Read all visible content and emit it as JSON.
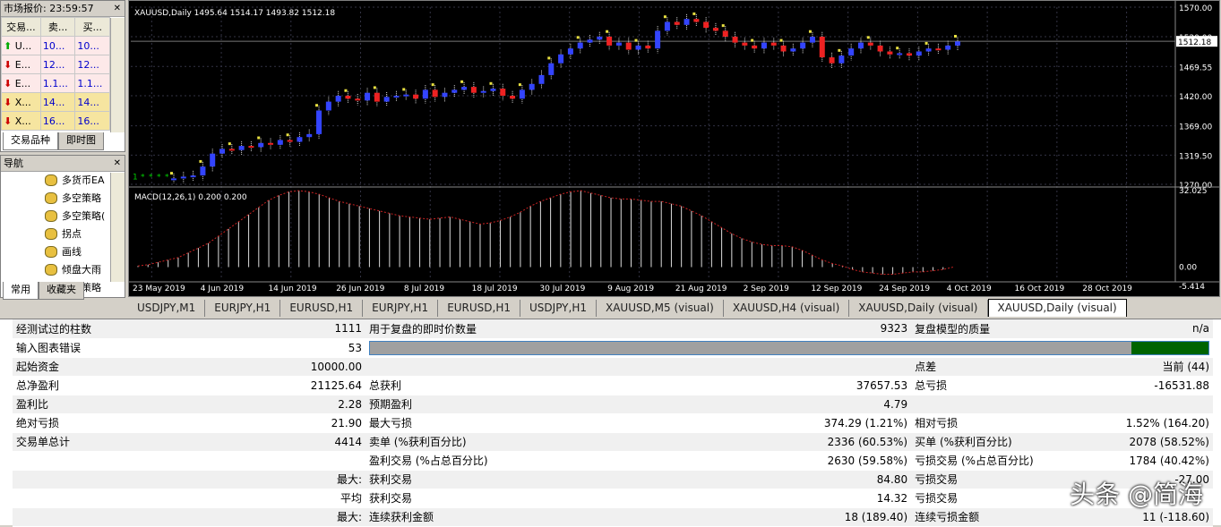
{
  "market_watch": {
    "title": "市场报价: 23:59:57",
    "col_symbol": "交易...",
    "col_bid": "卖...",
    "col_ask": "买...",
    "rows": [
      {
        "symbol": "U...",
        "bid": "10...",
        "ask": "10...",
        "dir": "up"
      },
      {
        "symbol": "E...",
        "bid": "12...",
        "ask": "12...",
        "dir": "down"
      },
      {
        "symbol": "E...",
        "bid": "1.1...",
        "ask": "1.1...",
        "dir": "down"
      },
      {
        "symbol": "X...",
        "bid": "14...",
        "ask": "14...",
        "dir": "down"
      },
      {
        "symbol": "X...",
        "bid": "16...",
        "ask": "16...",
        "dir": "down"
      }
    ],
    "tab_symbols": "交易品种",
    "tab_tick": "即时图"
  },
  "navigator": {
    "title": "导航",
    "items": [
      "多货币EA",
      "多空策略",
      "多空策略(",
      "拐点",
      "画线",
      "倾盘大雨",
      "趋势策略"
    ],
    "tab_common": "常用",
    "tab_favorites": "收藏夹"
  },
  "chart": {
    "header": "XAUUSD,Daily  1495.64 1514.17 1493.82 1512.18",
    "macd_label": "MACD(12,26,1) 0.200 0.200",
    "price_ticks": [
      "1570.00",
      "1520.00",
      "1469.55",
      "1420.00",
      "1369.00",
      "1319.50",
      "1270.00"
    ],
    "current_price": "1512.18",
    "macd_ticks": [
      "32.025",
      "0.00",
      "-5.414"
    ],
    "date_ticks": [
      "23 May 2019",
      "4 Jun 2019",
      "14 Jun 2019",
      "26 Jun 2019",
      "8 Jul 2019",
      "18 Jul 2019",
      "30 Jul 2019",
      "9 Aug 2019",
      "21 Aug 2019",
      "2 Sep 2019",
      "12 Sep 2019",
      "24 Sep 2019",
      "4 Oct 2019",
      "16 Oct 2019",
      "28 Oct 2019"
    ],
    "price_close": [
      1280,
      1283,
      1285,
      1300,
      1322,
      1330,
      1328,
      1335,
      1333,
      1340,
      1337,
      1345,
      1342,
      1350,
      1355,
      1395,
      1410,
      1420,
      1415,
      1412,
      1425,
      1410,
      1418,
      1420,
      1422,
      1415,
      1430,
      1418,
      1425,
      1430,
      1435,
      1425,
      1428,
      1432,
      1420,
      1415,
      1430,
      1440,
      1455,
      1475,
      1490,
      1500,
      1510,
      1515,
      1520,
      1505,
      1510,
      1498,
      1505,
      1500,
      1530,
      1545,
      1540,
      1550,
      1545,
      1535,
      1530,
      1520,
      1510,
      1505,
      1500,
      1510,
      1505,
      1495,
      1500,
      1510,
      1520,
      1485,
      1475,
      1488,
      1500,
      1510,
      1505,
      1495,
      1490,
      1492,
      1488,
      1495,
      1500,
      1498,
      1505,
      1512
    ],
    "macd": [
      0.5,
      1,
      2,
      3,
      4,
      6,
      8,
      10,
      13,
      16,
      19,
      22,
      25,
      28,
      30,
      31.5,
      32,
      31.5,
      30.5,
      29,
      27.5,
      26.5,
      25.5,
      24.5,
      23.5,
      22.5,
      21.5,
      21,
      20.5,
      20,
      20.5,
      21,
      20,
      19,
      18,
      18.5,
      19.5,
      21,
      23,
      25.5,
      27.5,
      29,
      30.5,
      31.5,
      32,
      31,
      30,
      29,
      28.5,
      28.5,
      28,
      27.5,
      27.5,
      26.5,
      25.5,
      23.5,
      21.5,
      19,
      16.5,
      14,
      12,
      10.5,
      9.5,
      9,
      9,
      8.5,
      7,
      5,
      3,
      1.5,
      0.5,
      -1,
      -2,
      -2.5,
      -3,
      -3,
      -2.5,
      -2,
      -2,
      -1.5,
      -1,
      0
    ]
  },
  "chart_tabs": [
    "USDJPY,M1",
    "EURJPY,H1",
    "EURUSD,H1",
    "EURJPY,H1",
    "EURUSD,H1",
    "USDJPY,H1",
    "XAUUSD,M5 (visual)",
    "XAUUSD,H4 (visual)",
    "XAUUSD,Daily (visual)",
    "XAUUSD,Daily (visual)"
  ],
  "results": {
    "rows": [
      [
        "经测试过的柱数",
        "1111",
        "用于复盘的即时价数量",
        "9323",
        "复盘模型的质量",
        "n/a"
      ],
      [
        "输入图表错误",
        "53",
        "",
        "",
        "",
        ""
      ],
      [
        "起始资金",
        "10000.00",
        "",
        "",
        "点差",
        "当前 (44)"
      ],
      [
        "总净盈利",
        "21125.64",
        "总获利",
        "37657.53",
        "总亏损",
        "-16531.88"
      ],
      [
        "盈利比",
        "2.28",
        "预期盈利",
        "4.79",
        "",
        ""
      ],
      [
        "绝对亏损",
        "21.90",
        "最大亏损",
        "374.29 (1.21%)",
        "相对亏损",
        "1.52% (164.20)"
      ],
      [
        "交易单总计",
        "4414",
        "卖单 (%获利百分比)",
        "2336 (60.53%)",
        "买单 (%获利百分比)",
        "2078 (58.52%)"
      ],
      [
        "",
        "",
        "盈利交易 (%占总百分比)",
        "2630 (59.58%)",
        "亏损交易 (%占总百分比)",
        "1784 (40.42%)"
      ],
      [
        "",
        "最大:",
        "获利交易",
        "84.80",
        "亏损交易",
        "-27.00"
      ],
      [
        "",
        "平均",
        "获利交易",
        "14.32",
        "亏损交易",
        ""
      ],
      [
        "",
        "最大:",
        "连续获利金额",
        "18 (189.40)",
        "连续亏损金额",
        "11 (-118.60)"
      ]
    ]
  },
  "watermark": "头条 @简海"
}
